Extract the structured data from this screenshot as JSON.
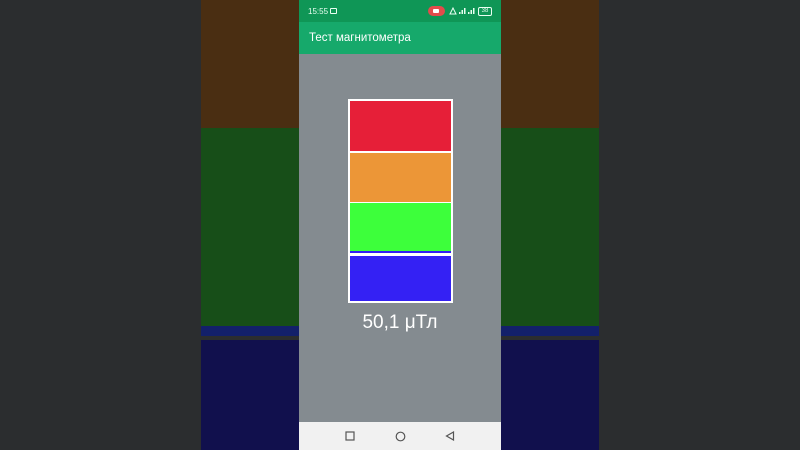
{
  "status_bar": {
    "time": "15:55",
    "battery": "38"
  },
  "app_bar": {
    "title": "Тест магнитометра"
  },
  "meter": {
    "segments": [
      {
        "name": "red",
        "color": "#e61f38"
      },
      {
        "name": "orange",
        "color": "#ec9637"
      },
      {
        "name": "green",
        "color": "#3dff3b"
      },
      {
        "name": "blue",
        "color": "#3421f4"
      }
    ],
    "value_text": "50,1 μТл"
  },
  "nav_bar": {
    "recents_icon": "square-icon",
    "home_icon": "circle-icon",
    "back_icon": "triangle-back-icon"
  },
  "colors": {
    "accent": "#16a96b",
    "status_bar": "#0f9656",
    "content_bg": "#848b90"
  }
}
